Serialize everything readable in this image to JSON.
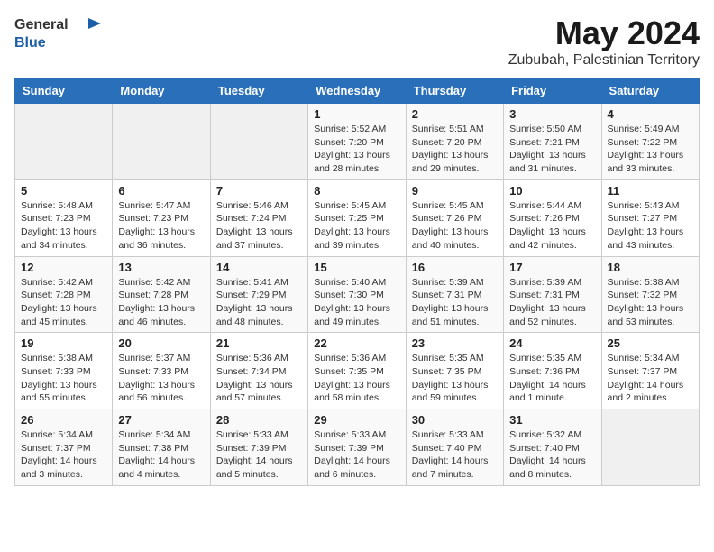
{
  "header": {
    "logo_general": "General",
    "logo_blue": "Blue",
    "month_title": "May 2024",
    "location": "Zububah, Palestinian Territory"
  },
  "weekdays": [
    "Sunday",
    "Monday",
    "Tuesday",
    "Wednesday",
    "Thursday",
    "Friday",
    "Saturday"
  ],
  "weeks": [
    [
      {
        "day": "",
        "info": ""
      },
      {
        "day": "",
        "info": ""
      },
      {
        "day": "",
        "info": ""
      },
      {
        "day": "1",
        "info": "Sunrise: 5:52 AM\nSunset: 7:20 PM\nDaylight: 13 hours\nand 28 minutes."
      },
      {
        "day": "2",
        "info": "Sunrise: 5:51 AM\nSunset: 7:20 PM\nDaylight: 13 hours\nand 29 minutes."
      },
      {
        "day": "3",
        "info": "Sunrise: 5:50 AM\nSunset: 7:21 PM\nDaylight: 13 hours\nand 31 minutes."
      },
      {
        "day": "4",
        "info": "Sunrise: 5:49 AM\nSunset: 7:22 PM\nDaylight: 13 hours\nand 33 minutes."
      }
    ],
    [
      {
        "day": "5",
        "info": "Sunrise: 5:48 AM\nSunset: 7:23 PM\nDaylight: 13 hours\nand 34 minutes."
      },
      {
        "day": "6",
        "info": "Sunrise: 5:47 AM\nSunset: 7:23 PM\nDaylight: 13 hours\nand 36 minutes."
      },
      {
        "day": "7",
        "info": "Sunrise: 5:46 AM\nSunset: 7:24 PM\nDaylight: 13 hours\nand 37 minutes."
      },
      {
        "day": "8",
        "info": "Sunrise: 5:45 AM\nSunset: 7:25 PM\nDaylight: 13 hours\nand 39 minutes."
      },
      {
        "day": "9",
        "info": "Sunrise: 5:45 AM\nSunset: 7:26 PM\nDaylight: 13 hours\nand 40 minutes."
      },
      {
        "day": "10",
        "info": "Sunrise: 5:44 AM\nSunset: 7:26 PM\nDaylight: 13 hours\nand 42 minutes."
      },
      {
        "day": "11",
        "info": "Sunrise: 5:43 AM\nSunset: 7:27 PM\nDaylight: 13 hours\nand 43 minutes."
      }
    ],
    [
      {
        "day": "12",
        "info": "Sunrise: 5:42 AM\nSunset: 7:28 PM\nDaylight: 13 hours\nand 45 minutes."
      },
      {
        "day": "13",
        "info": "Sunrise: 5:42 AM\nSunset: 7:28 PM\nDaylight: 13 hours\nand 46 minutes."
      },
      {
        "day": "14",
        "info": "Sunrise: 5:41 AM\nSunset: 7:29 PM\nDaylight: 13 hours\nand 48 minutes."
      },
      {
        "day": "15",
        "info": "Sunrise: 5:40 AM\nSunset: 7:30 PM\nDaylight: 13 hours\nand 49 minutes."
      },
      {
        "day": "16",
        "info": "Sunrise: 5:39 AM\nSunset: 7:31 PM\nDaylight: 13 hours\nand 51 minutes."
      },
      {
        "day": "17",
        "info": "Sunrise: 5:39 AM\nSunset: 7:31 PM\nDaylight: 13 hours\nand 52 minutes."
      },
      {
        "day": "18",
        "info": "Sunrise: 5:38 AM\nSunset: 7:32 PM\nDaylight: 13 hours\nand 53 minutes."
      }
    ],
    [
      {
        "day": "19",
        "info": "Sunrise: 5:38 AM\nSunset: 7:33 PM\nDaylight: 13 hours\nand 55 minutes."
      },
      {
        "day": "20",
        "info": "Sunrise: 5:37 AM\nSunset: 7:33 PM\nDaylight: 13 hours\nand 56 minutes."
      },
      {
        "day": "21",
        "info": "Sunrise: 5:36 AM\nSunset: 7:34 PM\nDaylight: 13 hours\nand 57 minutes."
      },
      {
        "day": "22",
        "info": "Sunrise: 5:36 AM\nSunset: 7:35 PM\nDaylight: 13 hours\nand 58 minutes."
      },
      {
        "day": "23",
        "info": "Sunrise: 5:35 AM\nSunset: 7:35 PM\nDaylight: 13 hours\nand 59 minutes."
      },
      {
        "day": "24",
        "info": "Sunrise: 5:35 AM\nSunset: 7:36 PM\nDaylight: 14 hours\nand 1 minute."
      },
      {
        "day": "25",
        "info": "Sunrise: 5:34 AM\nSunset: 7:37 PM\nDaylight: 14 hours\nand 2 minutes."
      }
    ],
    [
      {
        "day": "26",
        "info": "Sunrise: 5:34 AM\nSunset: 7:37 PM\nDaylight: 14 hours\nand 3 minutes."
      },
      {
        "day": "27",
        "info": "Sunrise: 5:34 AM\nSunset: 7:38 PM\nDaylight: 14 hours\nand 4 minutes."
      },
      {
        "day": "28",
        "info": "Sunrise: 5:33 AM\nSunset: 7:39 PM\nDaylight: 14 hours\nand 5 minutes."
      },
      {
        "day": "29",
        "info": "Sunrise: 5:33 AM\nSunset: 7:39 PM\nDaylight: 14 hours\nand 6 minutes."
      },
      {
        "day": "30",
        "info": "Sunrise: 5:33 AM\nSunset: 7:40 PM\nDaylight: 14 hours\nand 7 minutes."
      },
      {
        "day": "31",
        "info": "Sunrise: 5:32 AM\nSunset: 7:40 PM\nDaylight: 14 hours\nand 8 minutes."
      },
      {
        "day": "",
        "info": ""
      }
    ]
  ]
}
